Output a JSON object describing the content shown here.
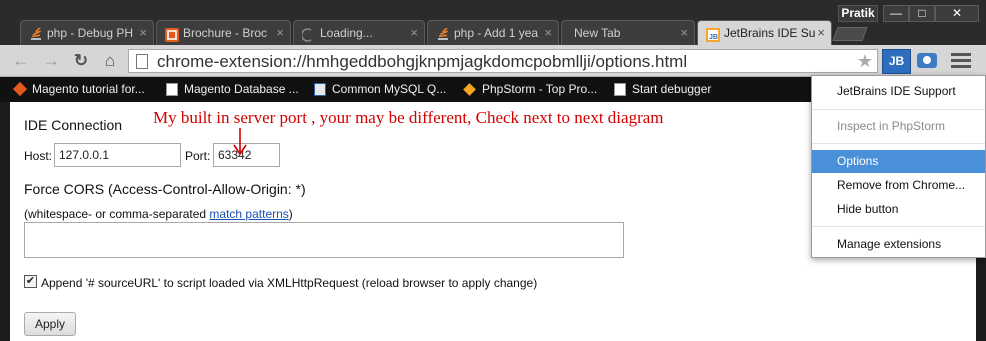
{
  "window": {
    "user_name": "Pratik",
    "minimize_glyph": "—",
    "maximize_glyph": "□",
    "close_glyph": "✕"
  },
  "tabs": [
    {
      "label": "php - Debug PH",
      "icon": "stackoverflow-icon"
    },
    {
      "label": "Brochure - Broc",
      "icon": "magento-icon"
    },
    {
      "label": "Loading...",
      "icon": "loading-spinner-icon"
    },
    {
      "label": "php - Add 1 yea",
      "icon": "stackoverflow-icon"
    },
    {
      "label": "New Tab",
      "icon": ""
    },
    {
      "label": "JetBrains IDE Su",
      "icon": "jetbrains-icon",
      "active": true
    }
  ],
  "tab_close_glyph": "×",
  "toolbar": {
    "back_glyph": "←",
    "forward_glyph": "→",
    "reload_glyph": "↻",
    "home_glyph": "⌂",
    "url": "chrome-extension://hmhgeddbohgjknpmjagkdomcpobmllji/options.html",
    "star_glyph": "★",
    "jb_extension_label": "JB"
  },
  "bookmarks": [
    {
      "label": "Magento tutorial for...",
      "icon": "magento-icon"
    },
    {
      "label": "Magento Database ...",
      "icon": "document-icon"
    },
    {
      "label": "Common MySQL Q...",
      "icon": "mysql-icon"
    },
    {
      "label": "PhpStorm - Top Pro...",
      "icon": "phpstorm-icon"
    },
    {
      "label": "Start debugger",
      "icon": "document-icon"
    }
  ],
  "options": {
    "ide_connection_title": "IDE Connection",
    "host_label": "Host:",
    "host_value": "127.0.0.1",
    "port_label": "Port:",
    "port_value": "63342",
    "cors_title": "Force CORS (Access-Control-Allow-Origin: *)",
    "cors_hint_prefix": "(whitespace- or comma-separated ",
    "cors_hint_link": "match patterns",
    "cors_hint_suffix": ")",
    "append_label": "Append '# sourceURL' to script loaded via XMLHttpRequest (reload browser to apply change)",
    "append_checked": true,
    "check_glyph": "✔",
    "apply_label": "Apply"
  },
  "annotation": {
    "text": "My built in server port , your may be different, Check next to next diagram",
    "color": "#d40000"
  },
  "extension_menu": {
    "items": [
      {
        "label": "JetBrains IDE Support",
        "state": "normal"
      },
      {
        "label": "Inspect in PhpStorm",
        "state": "disabled"
      },
      {
        "label": "Options",
        "state": "highlighted"
      },
      {
        "label": "Remove from Chrome...",
        "state": "normal"
      },
      {
        "label": "Hide button",
        "state": "normal"
      },
      {
        "label": "Manage extensions",
        "state": "normal"
      }
    ]
  },
  "colors": {
    "menu_highlight": "#4a90d9",
    "link": "#1a4fb5",
    "jb_button": "#2f6ebf"
  }
}
